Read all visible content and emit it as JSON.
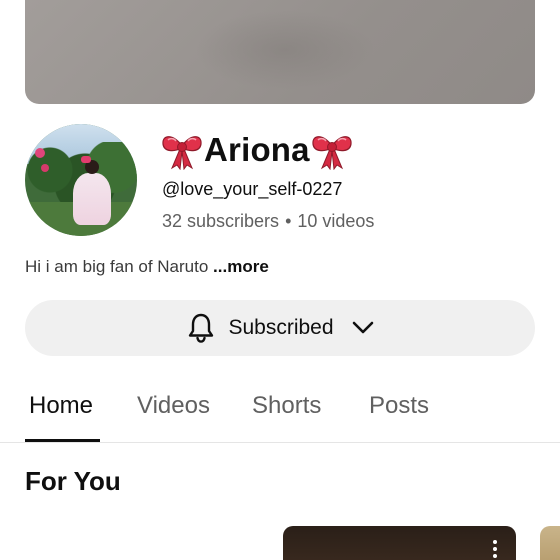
{
  "channel": {
    "name": "Ariona",
    "handle": "@love_your_self-0227",
    "subscribers": "32 subscribers",
    "separator": "•",
    "videos": "10 videos",
    "description": "Hi i am big fan of Naruto ",
    "more_label": "...more"
  },
  "subscribe": {
    "label": "Subscribed",
    "icon": "bell-icon",
    "dropdown_icon": "chevron-down-icon"
  },
  "tabs": [
    {
      "label": "Home",
      "active": true
    },
    {
      "label": "Videos",
      "active": false
    },
    {
      "label": "Shorts",
      "active": false
    },
    {
      "label": "Posts",
      "active": false
    }
  ],
  "section": {
    "title": "For You"
  },
  "colors": {
    "text_primary": "#0f0f0f",
    "text_secondary": "#606060",
    "button_bg": "#f0f0f0",
    "bow_red": "#e0314a"
  }
}
